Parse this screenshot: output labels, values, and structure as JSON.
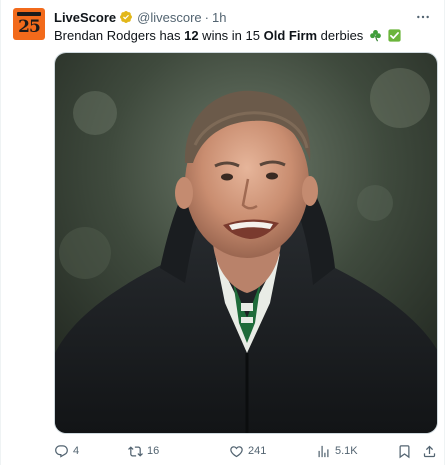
{
  "tweet": {
    "display_name": "LiveScore",
    "handle": "@livescore",
    "separator": "·",
    "time": "1h",
    "avatar_text": "25",
    "text": {
      "part1": "Brendan Rodgers has ",
      "bold1": "12",
      "part2": " wins in 15 ",
      "bold2": "Old Firm",
      "part3": " derbies"
    },
    "emojis": [
      "shamrock-icon",
      "check-mark-button-icon"
    ],
    "media_alt": "Photo of Brendan Rodgers in a black padded coat"
  },
  "actions": {
    "replies": "4",
    "retweets": "16",
    "likes": "241",
    "views": "5.1K"
  },
  "colors": {
    "text_primary": "#0f1419",
    "text_secondary": "#536471",
    "verified_gold": "#e2b719",
    "avatar_orange": "#f26a1b",
    "shamrock_green": "#3f9e3a",
    "check_green": "#6bb53b"
  }
}
